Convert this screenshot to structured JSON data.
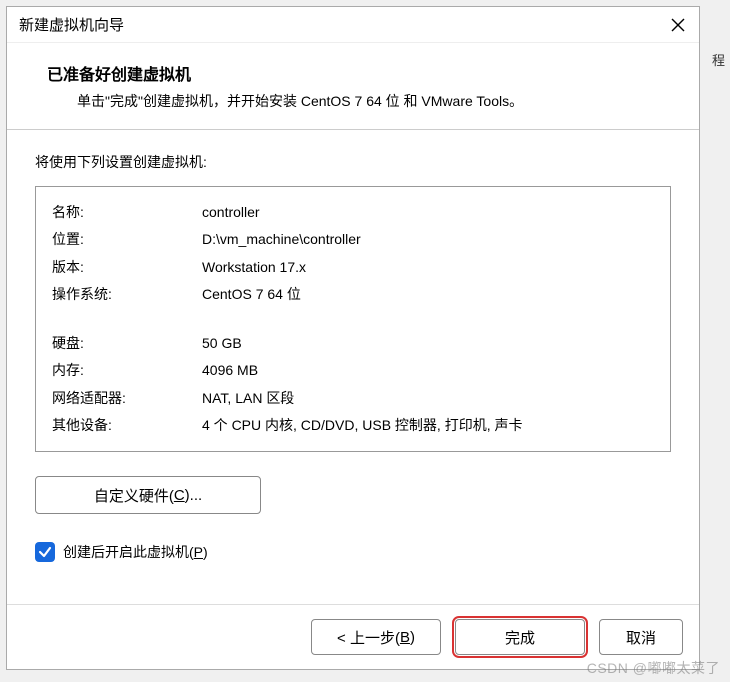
{
  "outer_fragment": "程",
  "titlebar": {
    "title": "新建虚拟机向导"
  },
  "header": {
    "title": "已准备好创建虚拟机",
    "subtitle": "单击\"完成\"创建虚拟机，并开始安装 CentOS 7 64 位 和 VMware Tools。"
  },
  "settings_label": "将使用下列设置创建虚拟机:",
  "settings": {
    "group1": [
      {
        "key": "名称:",
        "val": "controller"
      },
      {
        "key": "位置:",
        "val": "D:\\vm_machine\\controller"
      },
      {
        "key": "版本:",
        "val": "Workstation 17.x"
      },
      {
        "key": "操作系统:",
        "val": "CentOS 7 64 位"
      }
    ],
    "group2": [
      {
        "key": "硬盘:",
        "val": "50 GB"
      },
      {
        "key": "内存:",
        "val": "4096 MB"
      },
      {
        "key": "网络适配器:",
        "val": "NAT, LAN 区段"
      },
      {
        "key": "其他设备:",
        "val": "4 个 CPU 内核, CD/DVD, USB 控制器, 打印机, 声卡"
      }
    ]
  },
  "custom_hw": {
    "prefix": "自定义硬件(",
    "hotkey": "C",
    "suffix": ")..."
  },
  "checkbox": {
    "checked": true,
    "prefix": "创建后开启此虚拟机(",
    "hotkey": "P",
    "suffix": ")"
  },
  "footer": {
    "back": {
      "prefix": "< 上一步(",
      "hotkey": "B",
      "suffix": ")"
    },
    "finish": "完成",
    "cancel": "取消"
  },
  "watermark": "CSDN @嘟嘟太菜了"
}
